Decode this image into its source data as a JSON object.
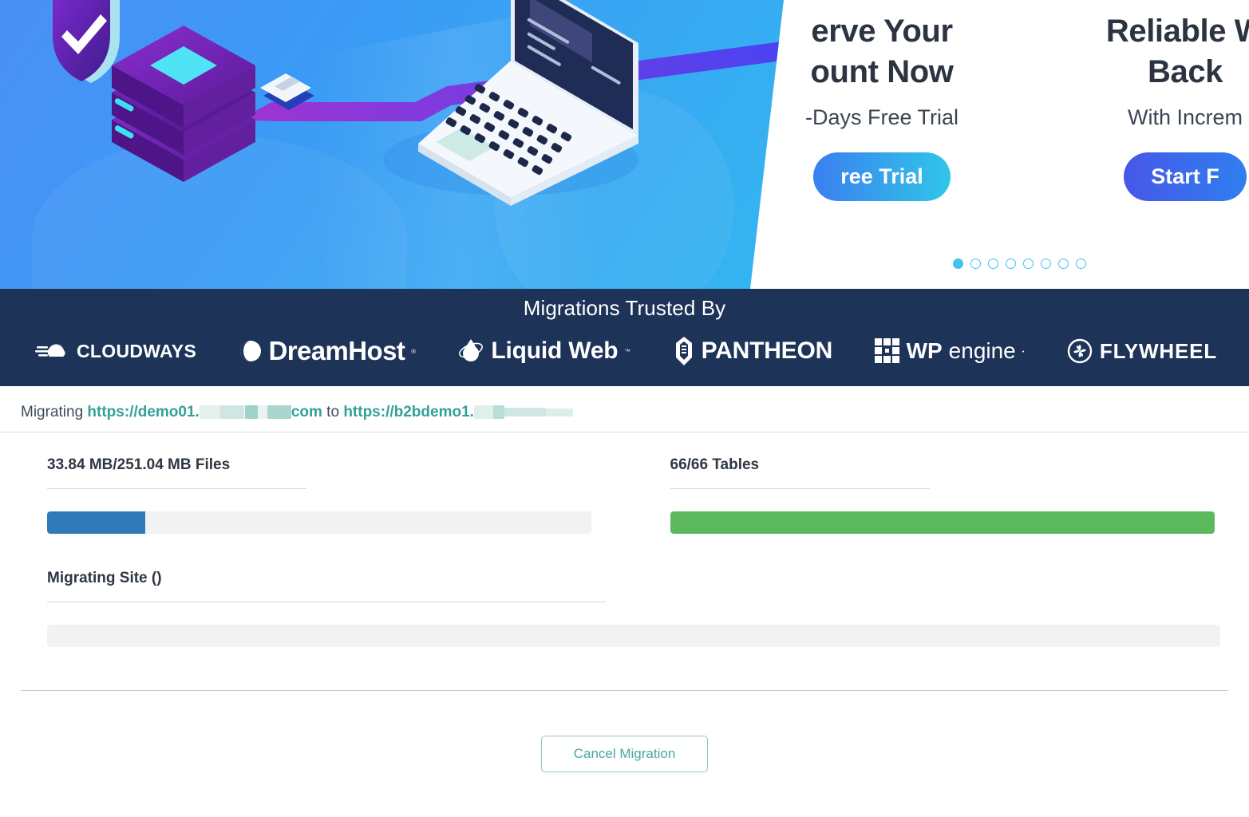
{
  "promo": {
    "cards": [
      {
        "title_line1": "erve Your",
        "title_line2": "ount Now",
        "subtitle": "-Days Free Trial",
        "button_label": "ree Trial",
        "button_style": "cyan"
      },
      {
        "title_line1": "Reliable W",
        "title_line2": "Back",
        "subtitle": "With Increm",
        "button_label": "Start F",
        "button_style": "blue"
      }
    ],
    "carousel": {
      "total_dots": 8,
      "active_index": 0,
      "active_color": "#3fc3f0"
    }
  },
  "trusted": {
    "title": "Migrations Trusted By",
    "logos": [
      {
        "name": "cloudways",
        "text": "CLOUDWAYS"
      },
      {
        "name": "dreamhost",
        "text": "DreamHost"
      },
      {
        "name": "liquidweb",
        "text": "Liquid Web"
      },
      {
        "name": "pantheon",
        "text": "PANTHEON"
      },
      {
        "name": "wpengine",
        "text_bold": "WP",
        "text_thin": "engine"
      },
      {
        "name": "flywheel",
        "text": "FLYWHEEL"
      }
    ],
    "background_color": "#1e3358"
  },
  "migration": {
    "prefix": "Migrating ",
    "source_url_visible": "https://demo01.",
    "source_url_tail": "com",
    "connector": " to ",
    "dest_url_visible": "https://b2bdemo1.",
    "link_color": "#32a198",
    "files": {
      "label": "33.84 MB/251.04 MB Files",
      "current_mb": 33.84,
      "total_mb": 251.04,
      "percent": 18,
      "bar_color": "#317ab9"
    },
    "tables": {
      "label": "66/66 Tables",
      "current": 66,
      "total": 66,
      "percent": 100,
      "bar_color": "#5cb85c"
    },
    "site": {
      "label": "Migrating Site ()",
      "percent": 0
    }
  },
  "footer": {
    "cancel_label": "Cancel Migration",
    "accent_color": "#4aa79f"
  }
}
